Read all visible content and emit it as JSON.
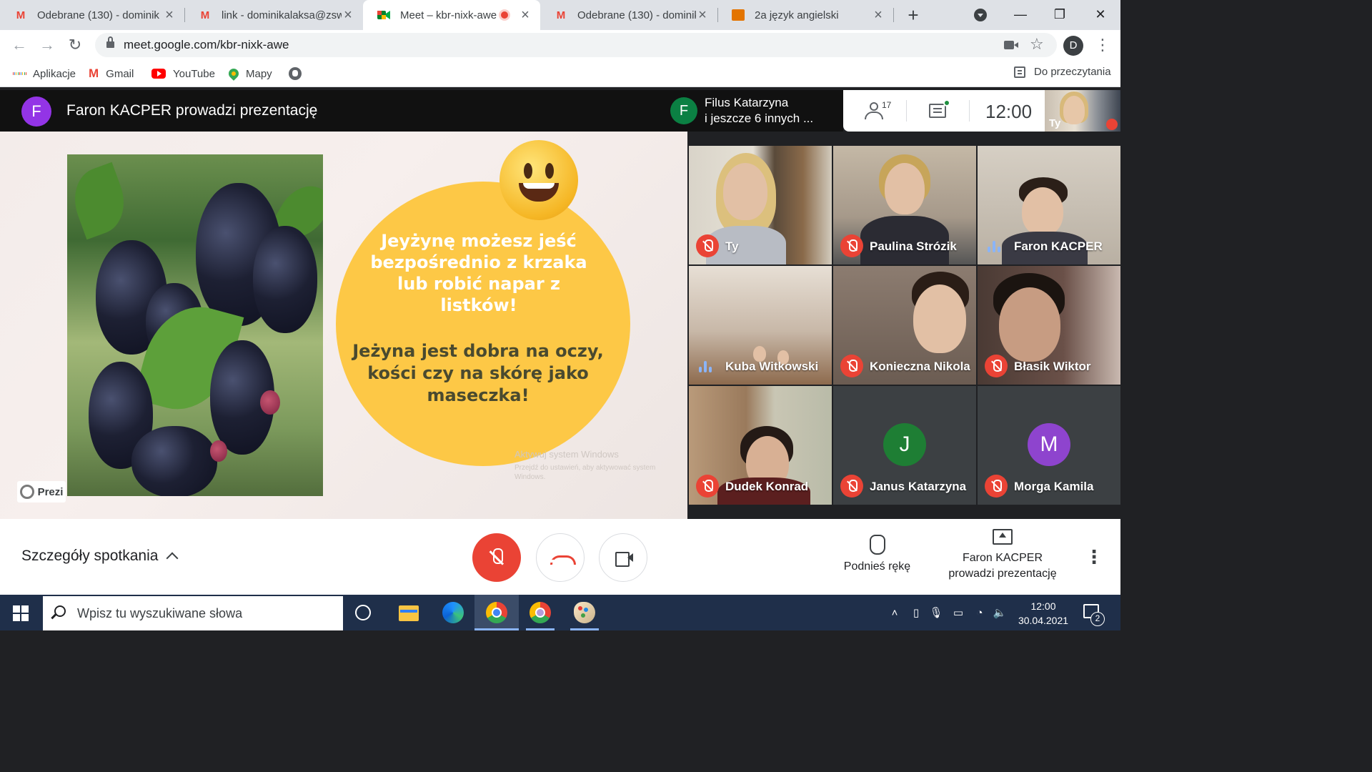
{
  "browser": {
    "tabs": [
      {
        "title": "Odebrane (130) - dominik",
        "icon": "gmail-icon"
      },
      {
        "title": "link - dominikalaksa@zsw",
        "icon": "gmail-icon"
      },
      {
        "title": "Meet – kbr-nixk-awe",
        "icon": "meet-icon",
        "active": true,
        "recording": true
      },
      {
        "title": "Odebrane (130) - dominik",
        "icon": "gmail-icon"
      },
      {
        "title": "2a język angielski",
        "icon": "classroom-icon"
      }
    ],
    "new_tab_label": "+",
    "url": "meet.google.com/kbr-nixk-awe",
    "profile_initial": "D",
    "bookmarks": [
      {
        "label": "Aplikacje",
        "icon": "apps-grid-icon"
      },
      {
        "label": "Gmail",
        "icon": "gmail-icon"
      },
      {
        "label": "YouTube",
        "icon": "youtube-icon"
      },
      {
        "label": "Mapy",
        "icon": "maps-pin-icon"
      },
      {
        "label": "",
        "icon": "globe-icon"
      }
    ],
    "reading_list_label": "Do przeczytania"
  },
  "meet": {
    "presenter_initial": "F",
    "presenter_banner": "Faron KACPER prowadzi prezentację",
    "other_participant": {
      "initial": "F",
      "line1": "Filus Katarzyna",
      "line2": "i jeszcze 6 innych ..."
    },
    "participant_count": "17",
    "time": "12:00",
    "self_label": "Ty",
    "slide": {
      "text_white": "Jeyżynę możesz jeść bezpośrednio z krzaka lub robić napar z listków!",
      "text_dark": "Jeżyna jest dobra na oczy, kości czy na skórę jako maseczka!",
      "brand": "Prezi",
      "watermark_title": "Aktywuj system Windows",
      "watermark_sub": "Przejdź do ustawień, aby aktywować system Windows."
    },
    "tiles": [
      {
        "name": "Ty",
        "mic": "muted"
      },
      {
        "name": "Paulina Strózik",
        "mic": "muted"
      },
      {
        "name": "Faron KACPER",
        "mic": "speaking"
      },
      {
        "name": "Kuba Witkowski",
        "mic": "speaking"
      },
      {
        "name": "Konieczna Nikola",
        "mic": "muted"
      },
      {
        "name": "Błasik Wiktor",
        "mic": "muted"
      },
      {
        "name": "Dudek Konrad",
        "mic": "muted"
      },
      {
        "name": "Janus Katarzyna",
        "mic": "muted",
        "initial": "J",
        "avatar_color": "#1e7e34"
      },
      {
        "name": "Morga Kamila",
        "mic": "muted",
        "initial": "M",
        "avatar_color": "#8e44ce"
      }
    ],
    "bottom": {
      "details_label": "Szczegóły spotkania",
      "raise_hand_label": "Podnieś rękę",
      "presenting_line1": "Faron KACPER",
      "presenting_line2": "prowadzi prezentację"
    }
  },
  "taskbar": {
    "search_placeholder": "Wpisz tu wyszukiwane słowa",
    "time": "12:00",
    "date": "30.04.2021",
    "notification_count": "2"
  },
  "colors": {
    "mute_red": "#ea4335",
    "accent_blue": "#8ab4f8",
    "slide_circle": "#fdc846"
  }
}
